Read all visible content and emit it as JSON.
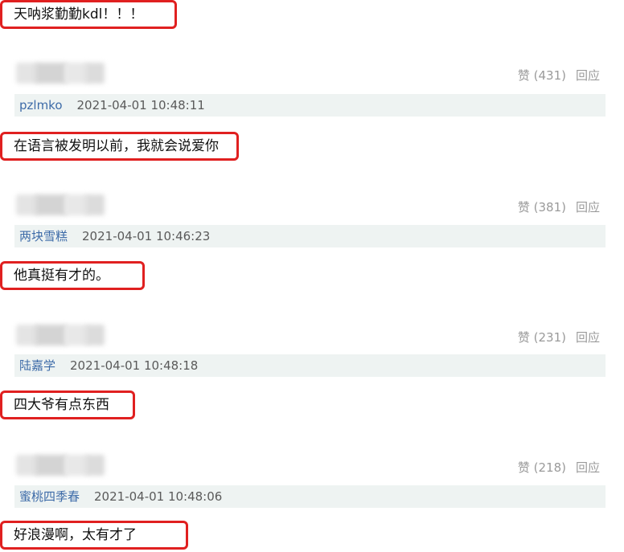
{
  "comments": [
    {
      "reply_text": "天呐浆勤勤kdl！！！"
    },
    {
      "likes": "赞 (431)",
      "reply_label": "回应",
      "user": "pzlmko",
      "time": "2021-04-01 10:48:11",
      "reply_text": "在语言被发明以前，我就会说爱你"
    },
    {
      "likes": "赞 (381)",
      "reply_label": "回应",
      "user": "两块雪糕",
      "time": "2021-04-01 10:46:23",
      "reply_text": "他真挺有才的。"
    },
    {
      "likes": "赞 (231)",
      "reply_label": "回应",
      "user": "陆嘉学",
      "time": "2021-04-01 10:48:18",
      "reply_text": "四大爷有点东西"
    },
    {
      "likes": "赞 (218)",
      "reply_label": "回应",
      "user": "蜜桃四季春",
      "time": "2021-04-01 10:48:06",
      "reply_text": "好浪漫啊，太有才了"
    }
  ],
  "colors": {
    "highlight_border": "#e02020",
    "username": "#3d6ba8",
    "meta_background": "#eef3f2"
  }
}
